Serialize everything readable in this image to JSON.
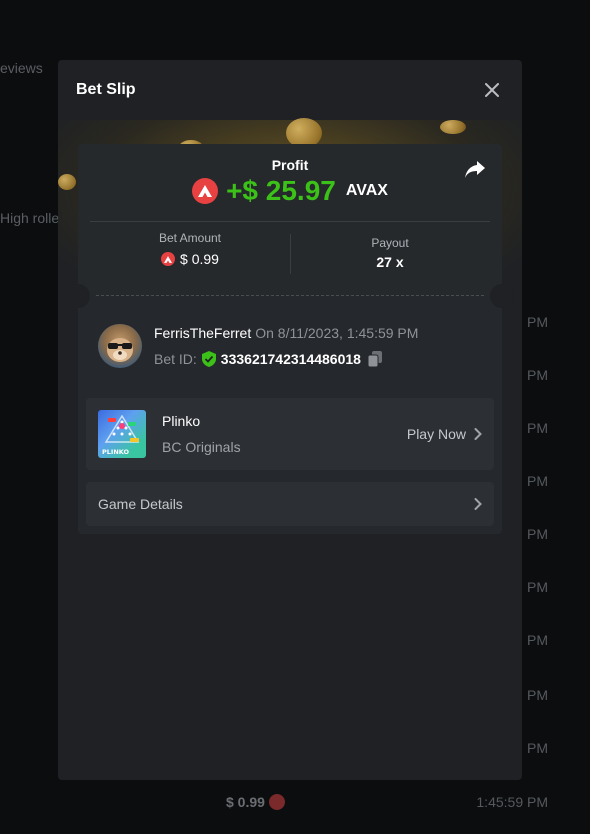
{
  "background": {
    "snippets": [
      "eviews",
      "High roller",
      "e"
    ],
    "times": [
      "PM",
      "PM",
      "PM",
      "PM",
      "PM",
      "PM",
      "PM",
      "PM",
      "PM"
    ],
    "footer_amount": "$ 0.99",
    "footer_time": "1:45:59 PM"
  },
  "modal": {
    "title": "Bet Slip",
    "profit_label": "Profit",
    "profit_value": "+$ 25.97",
    "profit_currency": "AVAX",
    "bet_amount_label": "Bet Amount",
    "bet_amount_value": "$ 0.99",
    "payout_label": "Payout",
    "payout_value": "27 x",
    "username": "FerrisTheFerret",
    "date": "On 8/11/2023, 1:45:59 PM",
    "bet_id_label": "Bet ID:",
    "bet_id_value": "333621742314486018",
    "game_name": "Plinko",
    "game_provider": "BC Originals",
    "play_now_label": "Play Now",
    "game_details_label": "Game Details",
    "game_thumb_label": "PLINKO"
  },
  "colors": {
    "profit_green": "#3bc117",
    "avax_red": "#e84142",
    "modal_bg": "#1f2124"
  }
}
